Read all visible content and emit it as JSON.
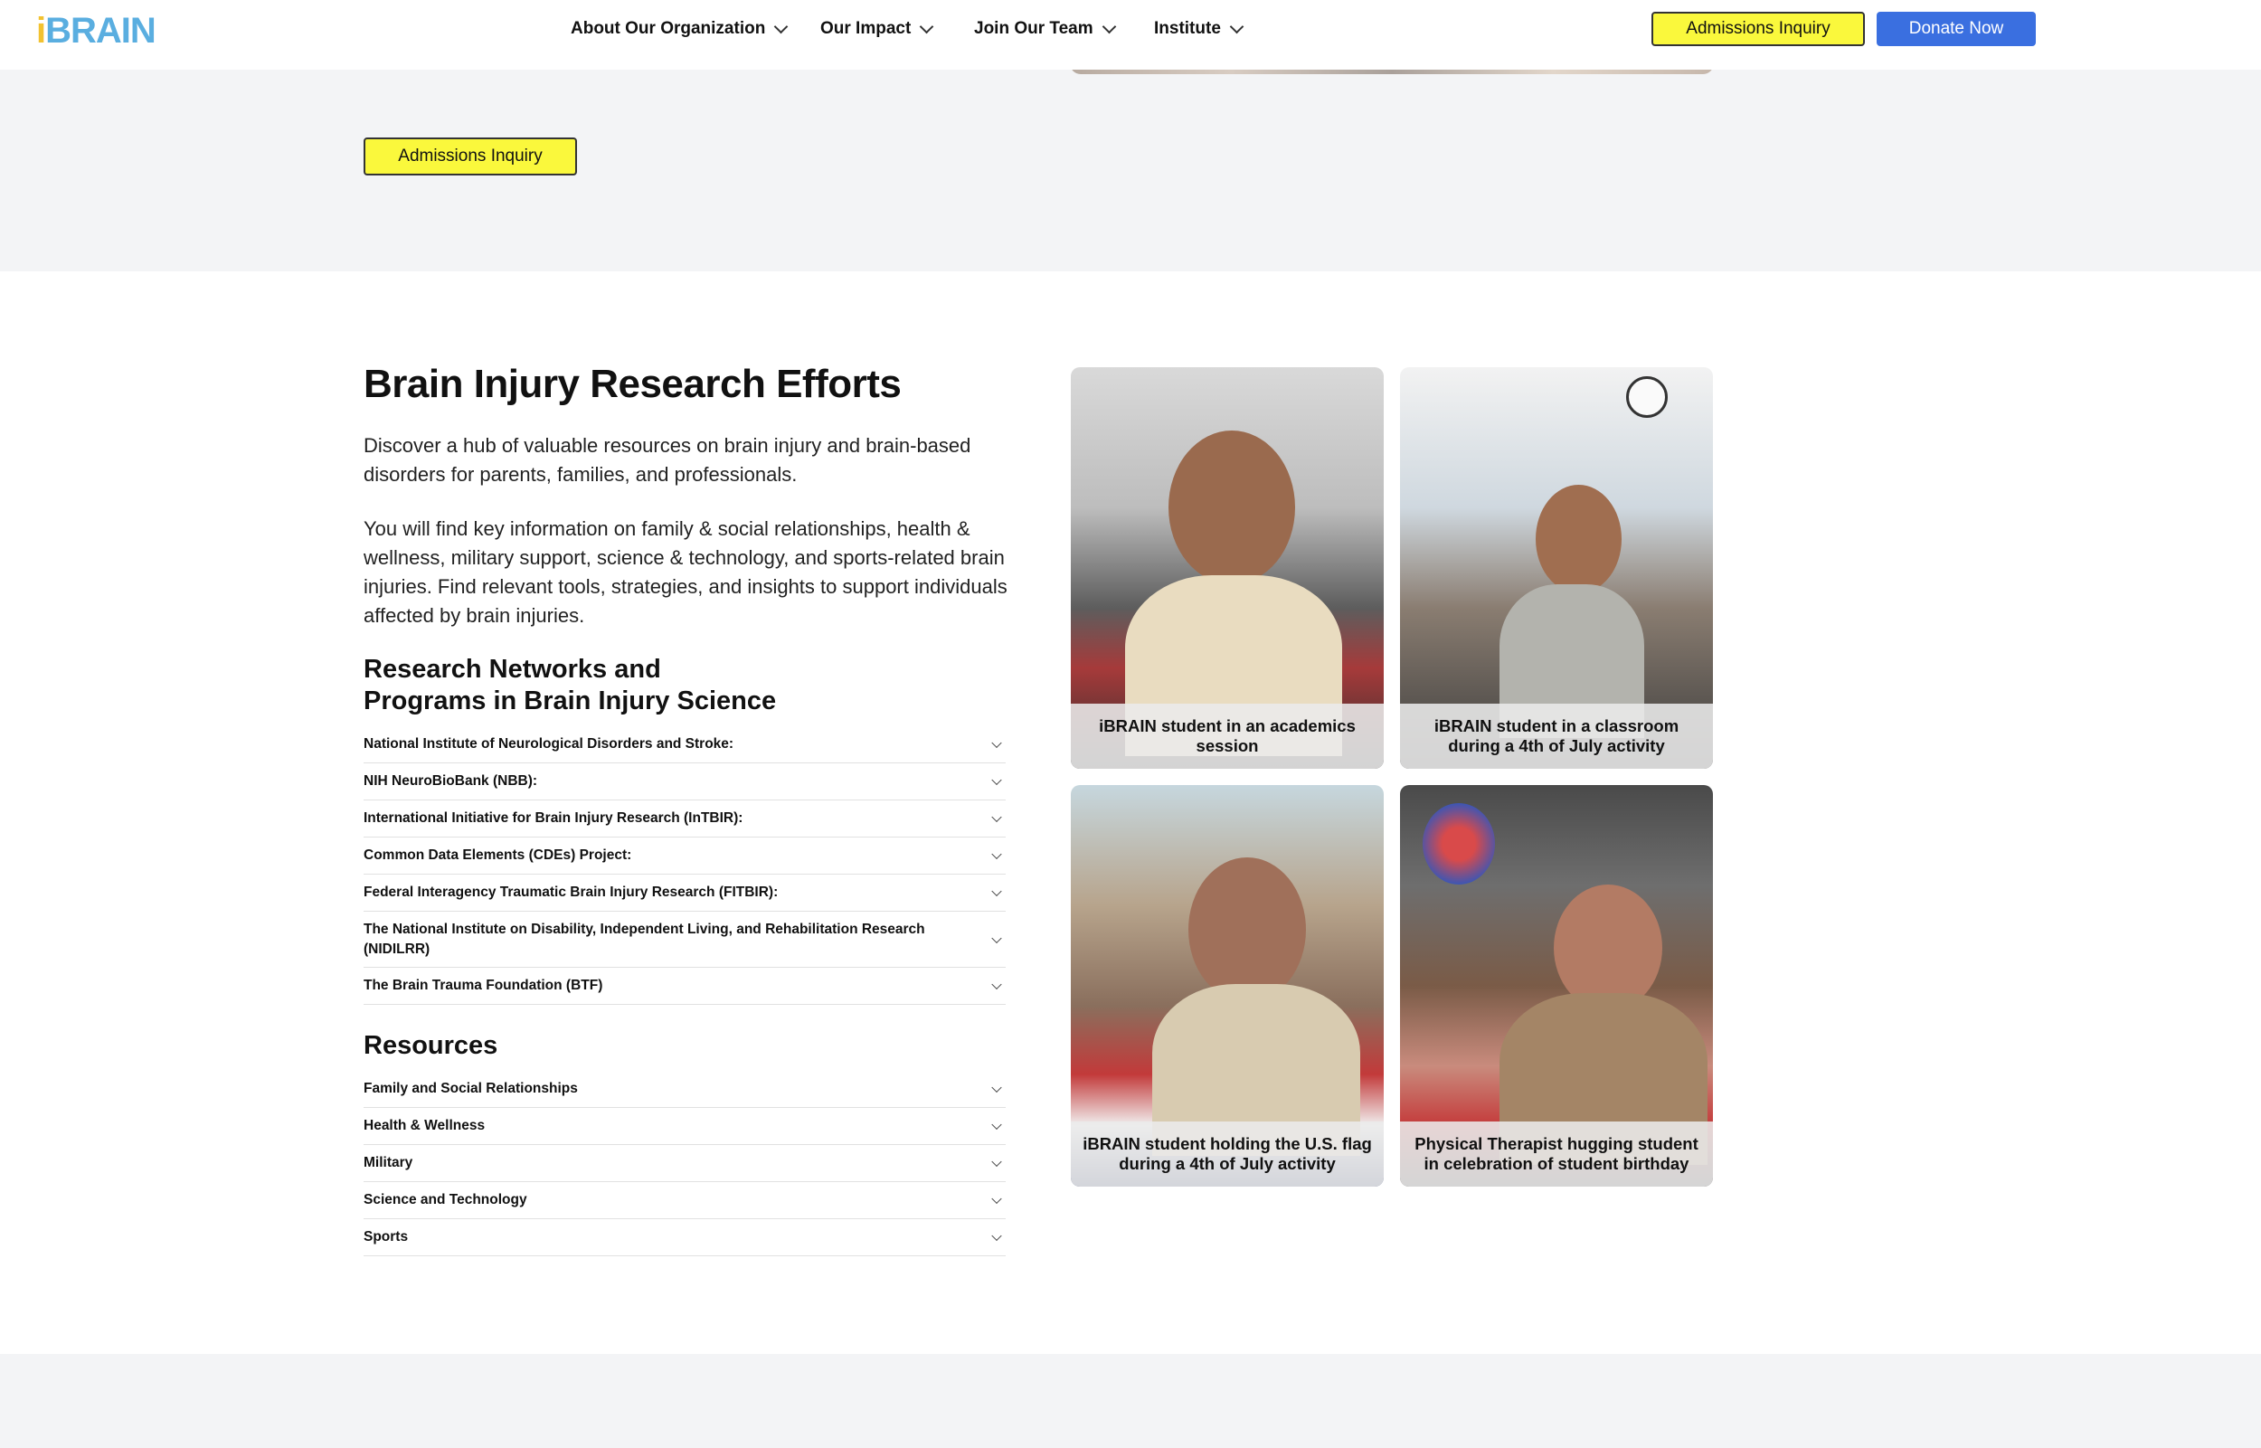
{
  "header": {
    "logo": "iBRAIN",
    "nav": [
      {
        "label": "About Our Organization"
      },
      {
        "label": "Our Impact"
      },
      {
        "label": "Join Our Team"
      },
      {
        "label": "Institute"
      }
    ],
    "admissions_label": "Admissions Inquiry",
    "donate_label": "Donate Now"
  },
  "hero_band": {
    "admissions_label": "Admissions Inquiry"
  },
  "research": {
    "title": "Brain Injury Research Efforts",
    "para1": "Discover a hub of valuable resources on brain injury and brain-based disorders for parents, families, and professionals.",
    "para2": "You will find key information on family & social relationships, health & wellness, military support, science & technology, and sports-related brain injuries. Find relevant tools, strategies, and insights to support individuals affected by brain injuries.",
    "networks_title": "Research Networks and Programs in Brain Injury Science",
    "networks": [
      "National Institute of Neurological Disorders and Stroke:",
      "NIH NeuroBioBank (NBB):",
      "International Initiative for Brain Injury Research (InTBIR):",
      "Common Data Elements (CDEs) Project:",
      "Federal Interagency Traumatic Brain Injury Research (FITBIR):",
      "The National Institute on Disability, Independent Living, and Rehabilitation Research (NIDILRR)",
      "The Brain Trauma Foundation (BTF)"
    ],
    "resources_title": "Resources",
    "resources": [
      "Family and Social Relationships",
      "Health & Wellness",
      "Military",
      "Science and Technology",
      "Sports"
    ]
  },
  "photos": [
    {
      "caption": "iBRAIN student in an academics session"
    },
    {
      "caption": "iBRAIN student in a classroom during a 4th of July activity"
    },
    {
      "caption": "iBRAIN student holding the U.S. flag during a 4th of July activity"
    },
    {
      "caption": "Physical Therapist hugging student in celebration of student birthday"
    }
  ],
  "colors": {
    "accent_yellow": "#faf83c",
    "accent_blue": "#3a6fe0",
    "logo_blue": "#5aaee0",
    "band_grey": "#f3f4f6"
  }
}
